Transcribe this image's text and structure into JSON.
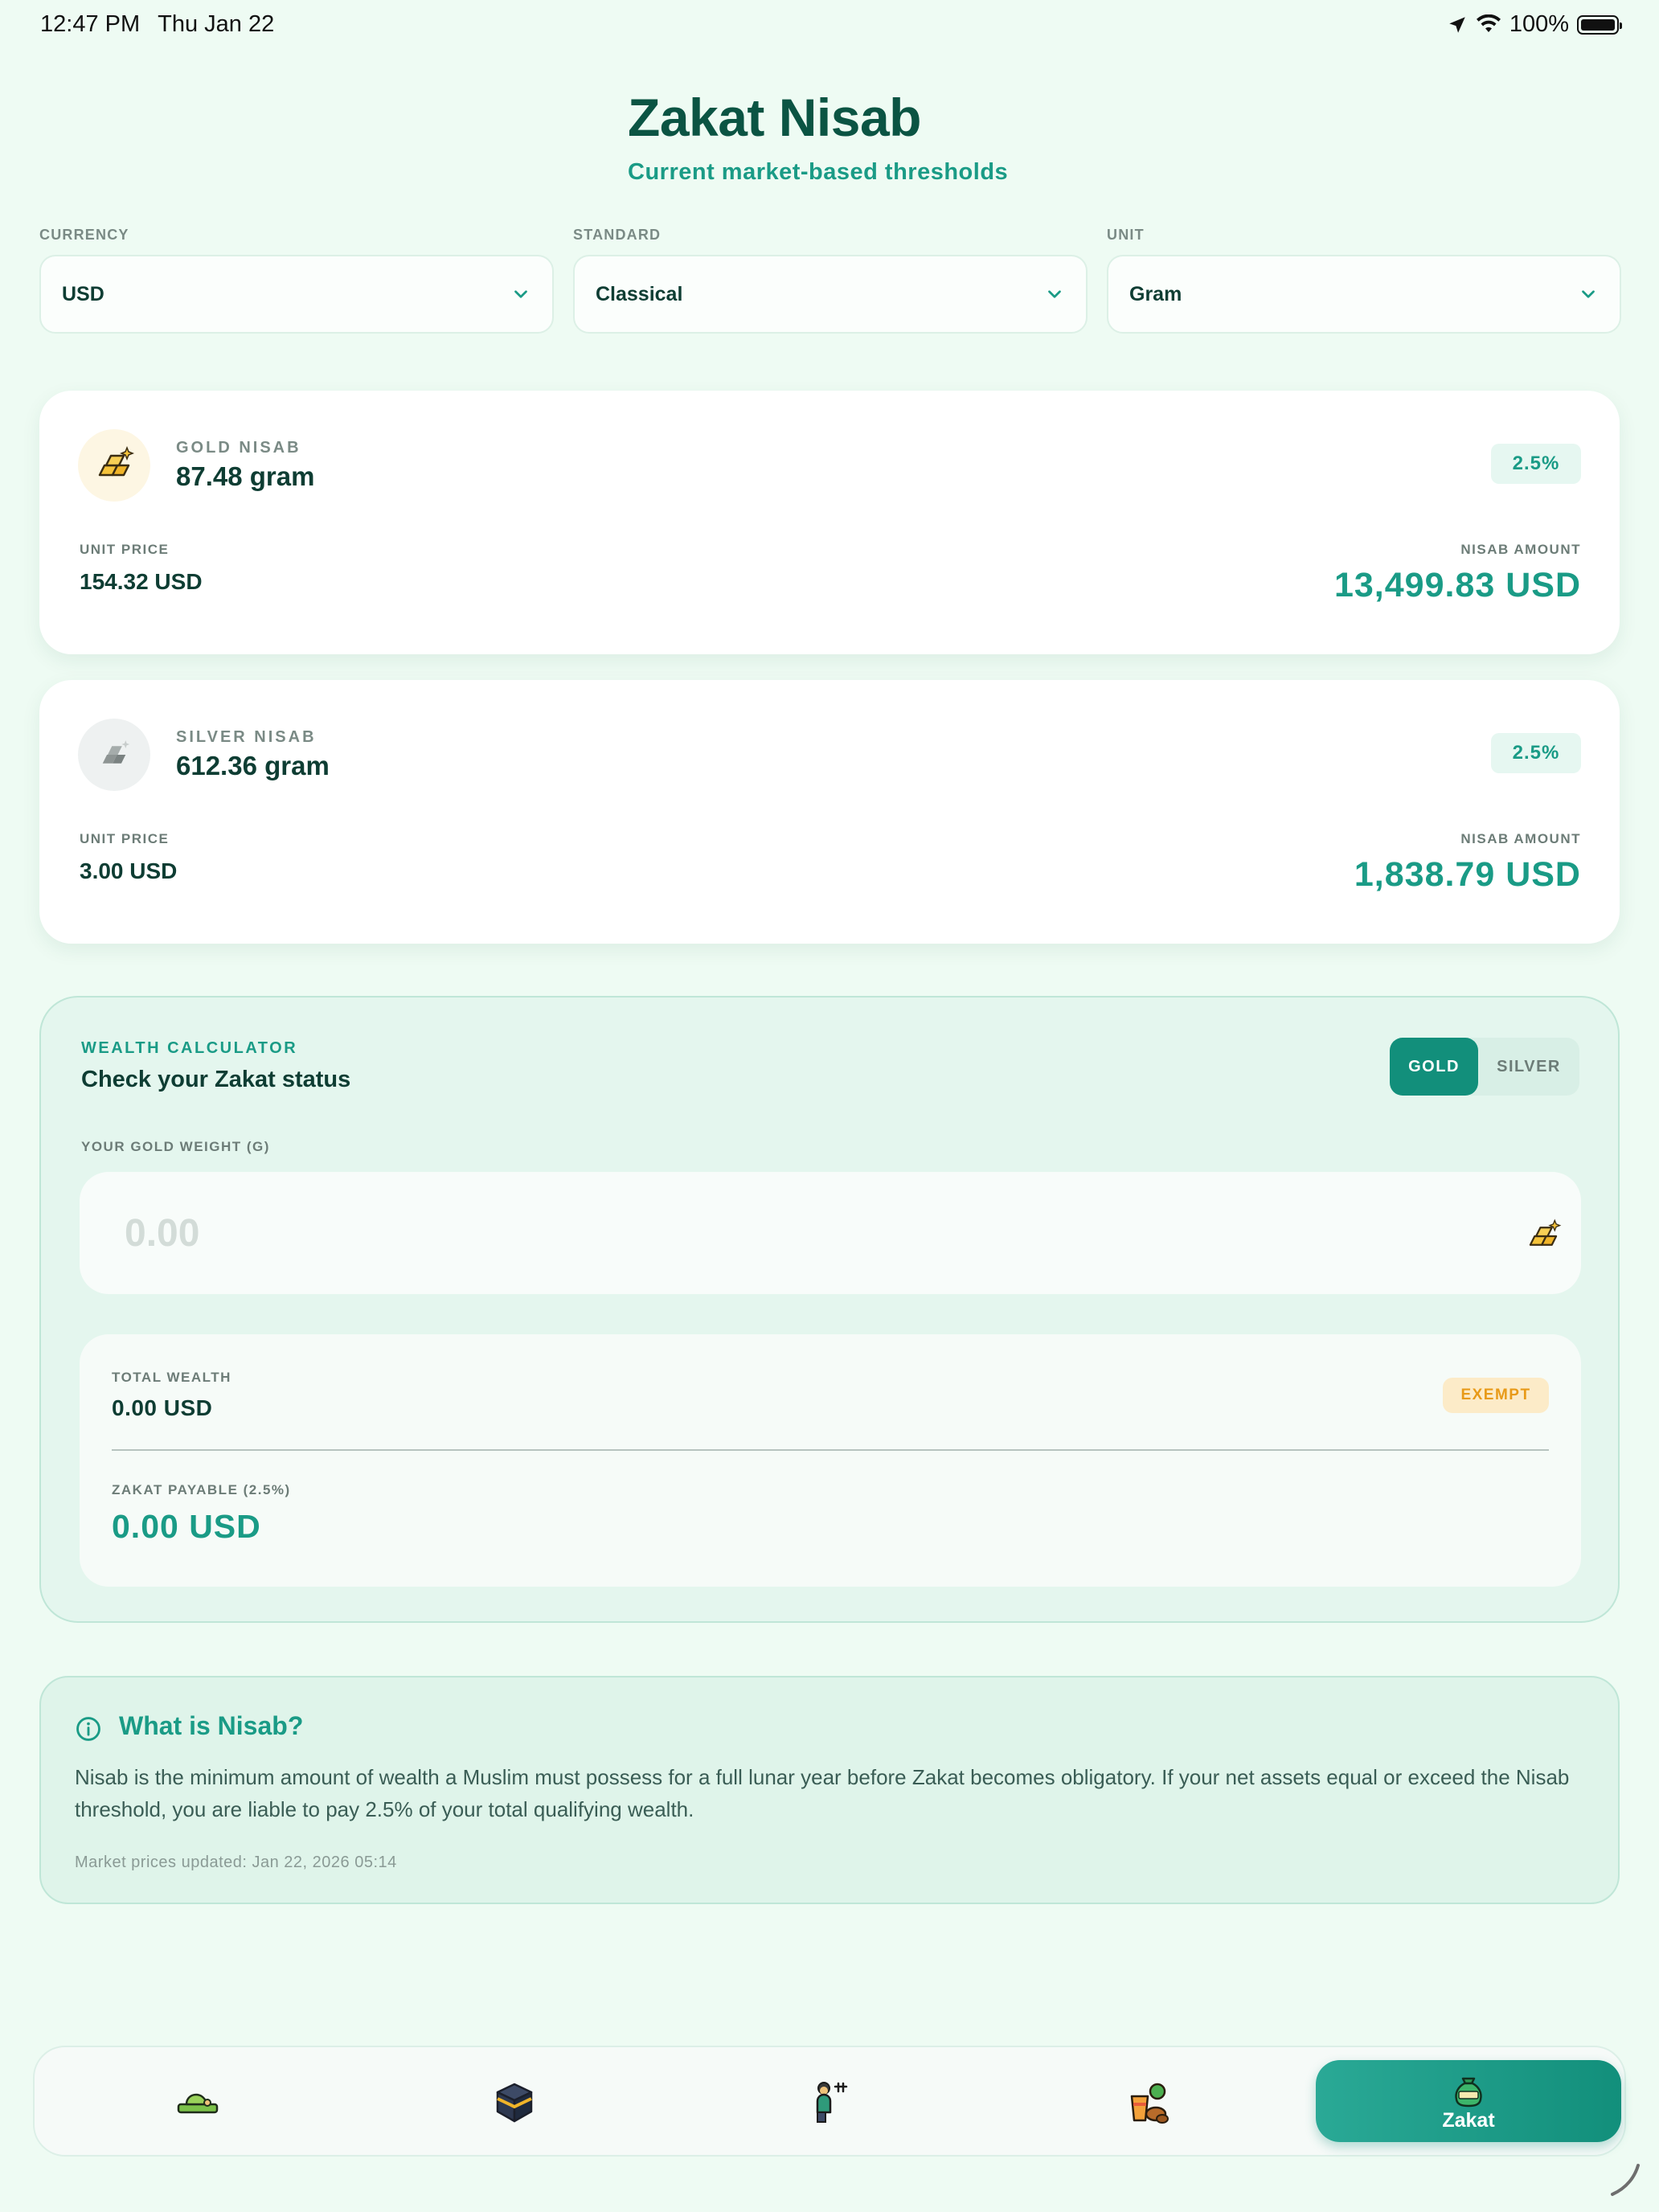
{
  "status_bar": {
    "time": "12:47 PM",
    "date": "Thu Jan 22",
    "battery": "100%"
  },
  "header": {
    "title": "Zakat Nisab",
    "subtitle": "Current market-based thresholds"
  },
  "selectors": {
    "currency": {
      "label": "CURRENCY",
      "value": "USD"
    },
    "standard": {
      "label": "STANDARD",
      "value": "Classical"
    },
    "unit": {
      "label": "UNIT",
      "value": "Gram"
    }
  },
  "gold_card": {
    "kicker": "GOLD NISAB",
    "weight": "87.48 gram",
    "rate": "2.5%",
    "unit_price_label": "UNIT PRICE",
    "unit_price": "154.32 USD",
    "amount_label": "NISAB AMOUNT",
    "amount": "13,499.83 USD",
    "icon": "gold-bars-icon"
  },
  "silver_card": {
    "kicker": "SILVER NISAB",
    "weight": "612.36 gram",
    "rate": "2.5%",
    "unit_price_label": "UNIT PRICE",
    "unit_price": "3.00 USD",
    "amount_label": "NISAB AMOUNT",
    "amount": "1,838.79 USD",
    "icon": "silver-bars-icon"
  },
  "calculator": {
    "kicker": "WEALTH CALCULATOR",
    "title": "Check your Zakat status",
    "toggle": {
      "gold": "GOLD",
      "silver": "SILVER",
      "selected": "GOLD"
    },
    "weight_label": "YOUR GOLD WEIGHT (G)",
    "weight_placeholder": "0.00",
    "total_label": "TOTAL WEALTH",
    "total_value": "0.00 USD",
    "status": "EXEMPT",
    "payable_label": "ZAKAT PAYABLE (2.5%)",
    "payable_value": "0.00 USD"
  },
  "info": {
    "title": "What is Nisab?",
    "body": "Nisab is the minimum amount of wealth a Muslim must possess for a full lunar year before Zakat becomes obligatory. If your net assets equal or exceed the Nisab threshold, you are liable to pay 2.5% of your total qualifying wealth.",
    "footnote": "Market prices updated: Jan 22, 2026 05:14"
  },
  "nav": {
    "items": [
      "prayer-mat-icon",
      "kaaba-icon",
      "prayer-person-icon",
      "iftar-food-icon"
    ],
    "active_label": "Zakat",
    "active_icon": "zakat-bag-icon"
  },
  "colors": {
    "accent": "#1a9b86",
    "accent_dark": "#128f7b",
    "title": "#0b5443",
    "background": "#eefbf3",
    "exempt": "#e89a18"
  }
}
